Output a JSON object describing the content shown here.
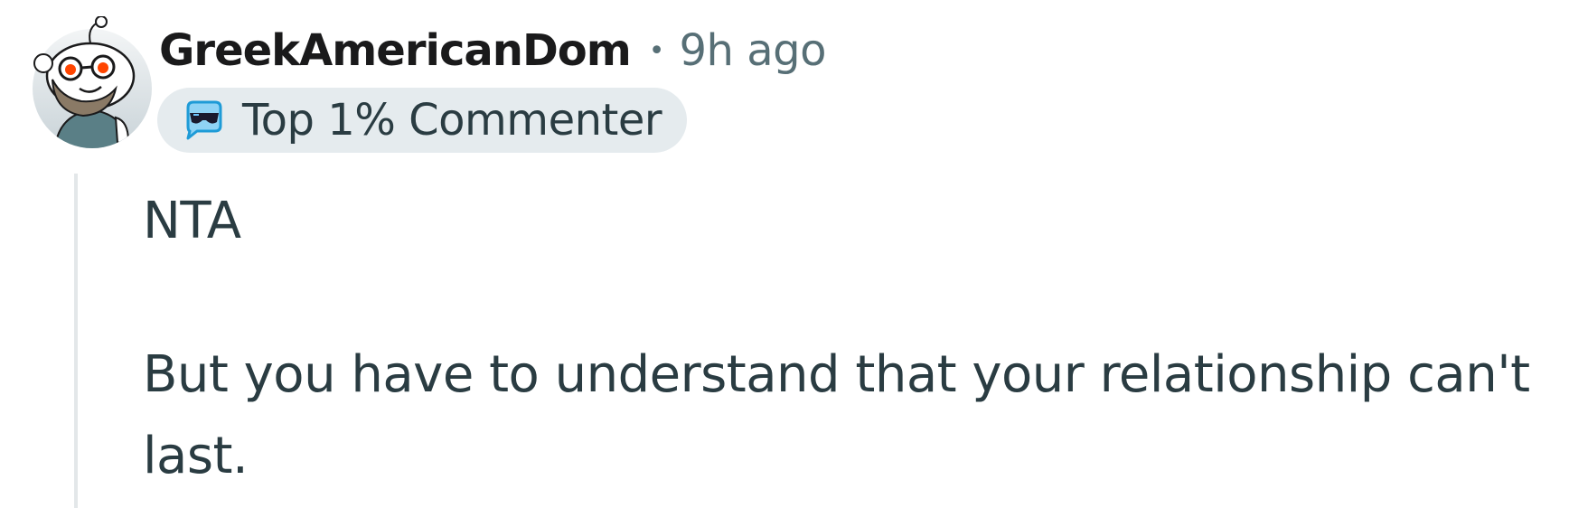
{
  "comment": {
    "author": "GreekAmericanDom",
    "separator": "•",
    "timestamp": "9h ago",
    "avatar_icon": "snoo-avatar-glasses-beard",
    "badge": {
      "icon": "sunglasses-chat-icon",
      "label": "Top 1% Commenter"
    },
    "body": {
      "paragraphs": [
        "NTA",
        "But you have to understand that your relationship can't last."
      ]
    }
  },
  "colors": {
    "author": "#1a1a1b",
    "meta": "#576f76",
    "body_text": "#2a3c42",
    "badge_bg": "#e5ebee",
    "thread_line": "#e3e7e9",
    "avatar_bg": "#d9e0e4",
    "avatar_eyes": "#ff4500",
    "badge_icon_accent": "#1e9bd7"
  }
}
